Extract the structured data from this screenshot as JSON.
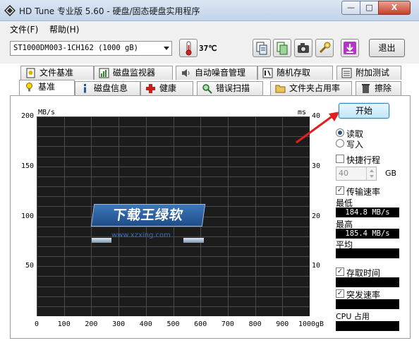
{
  "window": {
    "title": "HD Tune 专业版 5.60 - 硬盘/固态硬盘实用程序",
    "minimize": "—",
    "maximize": "□",
    "close": "X"
  },
  "menu": {
    "items": [
      "文件(F)",
      "帮助(H)"
    ]
  },
  "toolbar": {
    "drive": "ST1000DM003-1CH162 (1000 gB)",
    "temperature": "37℃",
    "exit_label": "退出",
    "icons": [
      "thermometer-icon",
      "copy-info-icon",
      "copy-icon",
      "camera-icon",
      "tools-icon",
      "download-icon"
    ]
  },
  "tabs": {
    "row1": [
      {
        "label": "文件基准",
        "icon": "file-benchmark-icon"
      },
      {
        "label": "磁盘监视器",
        "icon": "disk-monitor-icon"
      },
      {
        "label": "自动噪音管理",
        "icon": "noise-icon"
      },
      {
        "label": "随机存取",
        "icon": "random-access-icon"
      },
      {
        "label": "附加测试",
        "icon": "extra-tests-icon"
      }
    ],
    "row2": [
      {
        "label": "基准",
        "icon": "benchmark-icon",
        "active": true
      },
      {
        "label": "磁盘信息",
        "icon": "info-icon"
      },
      {
        "label": "健康",
        "icon": "health-icon"
      },
      {
        "label": "错误扫描",
        "icon": "error-scan-icon"
      },
      {
        "label": "文件夹占用率",
        "icon": "folder-icon"
      },
      {
        "label": "擦除",
        "icon": "erase-icon"
      }
    ]
  },
  "chart": {
    "left_unit": "MB/s",
    "right_unit": "ms",
    "y_left_ticks": [
      "200",
      "150",
      "100",
      "50"
    ],
    "y_right_ticks": [
      "40",
      "30",
      "20",
      "10"
    ],
    "x_ticks": [
      "0",
      "100",
      "200",
      "300",
      "400",
      "500",
      "600",
      "700",
      "800",
      "900",
      "1000gB"
    ]
  },
  "chart_data": {
    "type": "line",
    "title": "",
    "xlabel": "",
    "ylabel": "MB/s",
    "y2label": "ms",
    "xlim": [
      0,
      1000
    ],
    "ylim": [
      0,
      200
    ],
    "y2lim": [
      0,
      40
    ],
    "grid": true,
    "series": []
  },
  "watermark": {
    "text": "下载王绿软",
    "url": "www.xzxing.com"
  },
  "controls": {
    "start_label": "开始",
    "read_label": "读取",
    "write_label": "写入",
    "mode": "read",
    "short_stroke_label": "快捷行程",
    "short_stroke_checked": false,
    "short_stroke_value": "40",
    "short_stroke_unit": "GB",
    "transfer_rate_label": "传输速率",
    "transfer_rate_checked": true,
    "min_label": "最低",
    "min_value": "184.8 MB/s",
    "max_label": "最高",
    "max_value": "185.4 MB/s",
    "avg_label": "平均",
    "avg_value": "",
    "access_time_label": "存取时间",
    "access_time_checked": true,
    "access_time_value": "",
    "burst_rate_label": "突发速率",
    "burst_rate_checked": true,
    "burst_rate_value": "",
    "cpu_label": "CPU 占用",
    "cpu_value": "",
    "checkmark": "✓"
  },
  "colors": {
    "arrow": "#e02020",
    "chart_bg": "#1c1c1c",
    "grid": "#4a4a4a",
    "value_box_bg": "#000000"
  }
}
